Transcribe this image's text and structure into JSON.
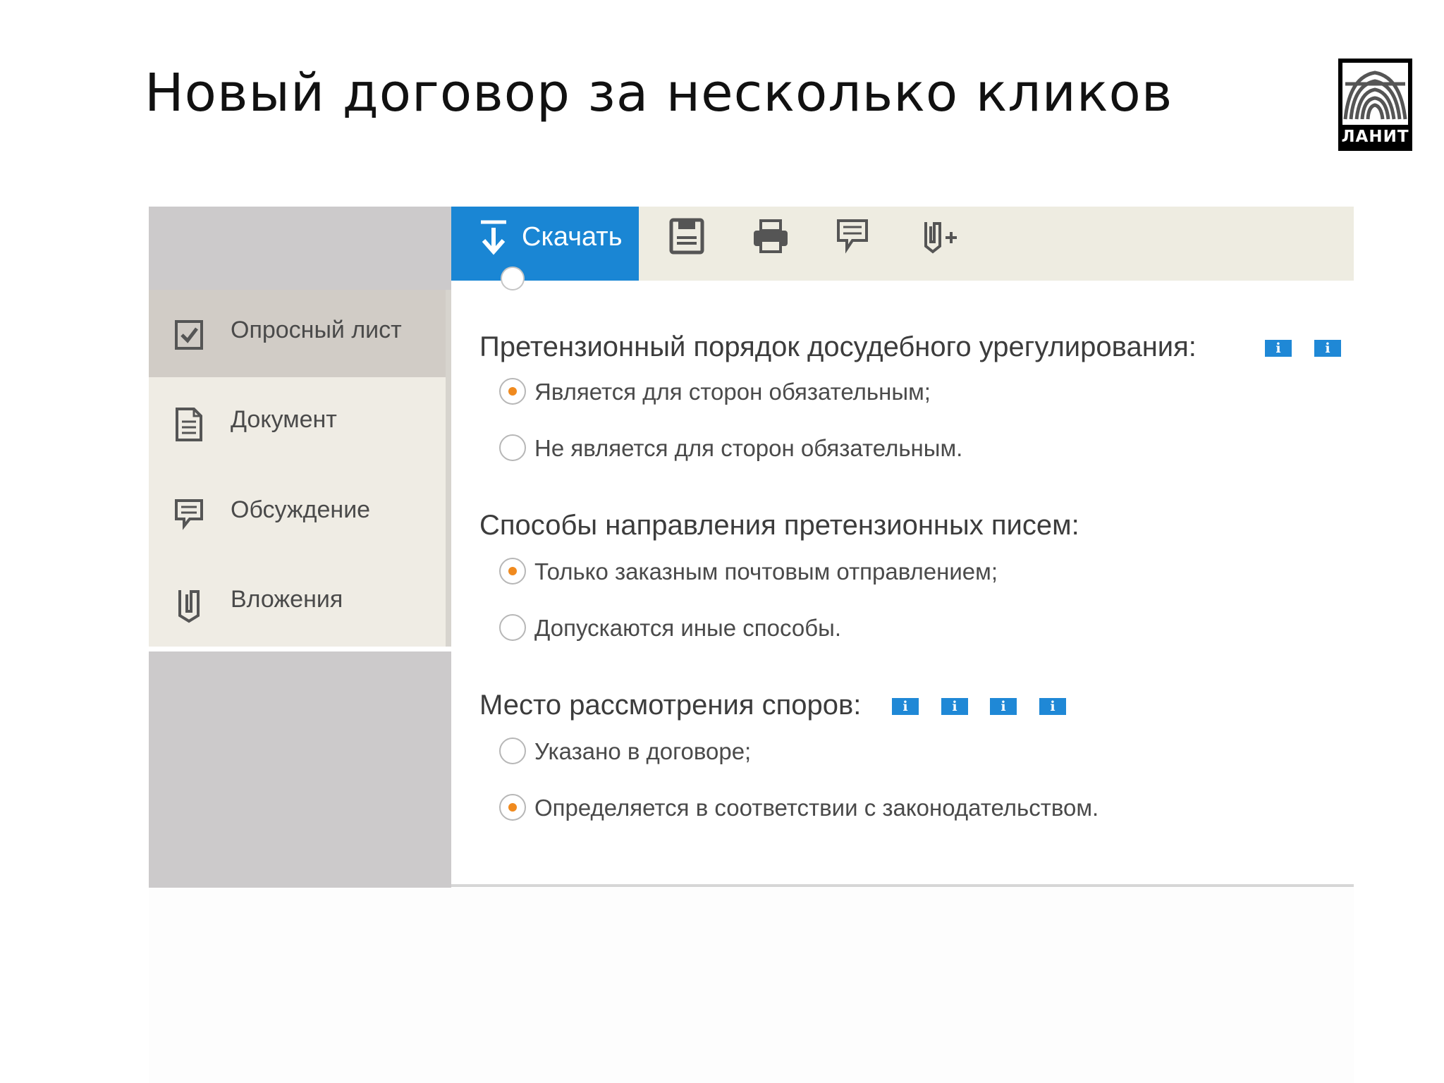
{
  "slide": {
    "title": "Новый договор за несколько кликов",
    "logo_text": "ЛАНИТ"
  },
  "sidebar": {
    "items": [
      {
        "label": "Опросный лист",
        "icon": "checkbox-icon",
        "active": true
      },
      {
        "label": "Документ",
        "icon": "document-icon",
        "active": false
      },
      {
        "label": "Обсуждение",
        "icon": "comment-icon",
        "active": false
      },
      {
        "label": "Вложения",
        "icon": "paperclip-icon",
        "active": false
      }
    ]
  },
  "toolbar": {
    "download_label": "Скачать",
    "icons": [
      "save-icon",
      "print-icon",
      "comment-icon",
      "attach-add-icon"
    ]
  },
  "form": {
    "sections": [
      {
        "title": "Претензионный порядок досудебного урегулирования:",
        "info_count": 2,
        "options": [
          {
            "label": "Является для сторон обязательным;",
            "checked": true
          },
          {
            "label": "Не является для сторон обязательным.",
            "checked": false
          }
        ]
      },
      {
        "title": "Способы направления претензионных писем:",
        "info_count": 0,
        "options": [
          {
            "label": "Только заказным почтовым отправлением;",
            "checked": true
          },
          {
            "label": "Допускаются иные способы.",
            "checked": false
          }
        ]
      },
      {
        "title": "Место рассмотрения споров:",
        "info_count": 4,
        "options": [
          {
            "label": "Указано в договоре;",
            "checked": false
          },
          {
            "label": "Определяется в соответствии с законодательством.",
            "checked": true
          }
        ]
      }
    ]
  },
  "colors": {
    "accent": "#1a86d4",
    "radio_selected": "#f08a1e",
    "sidebar_bg": "#efece4",
    "sidebar_active": "#d1ccc6",
    "toolbar_bg": "#eeece1"
  }
}
